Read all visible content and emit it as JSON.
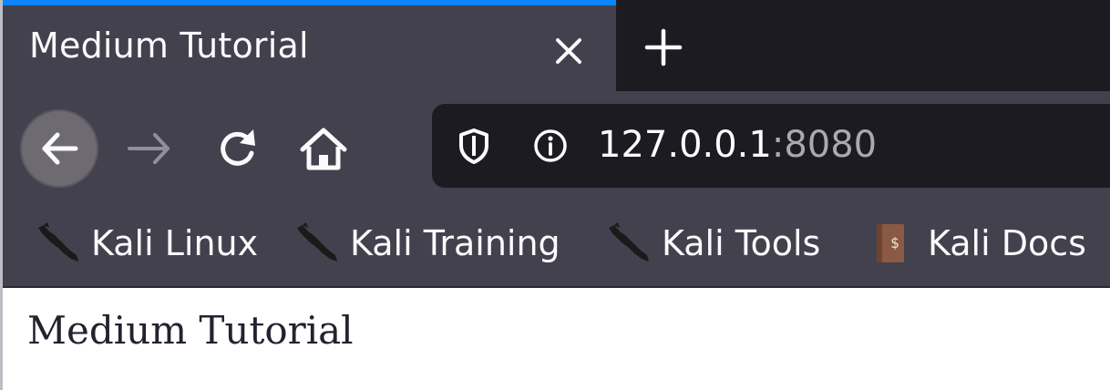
{
  "tab": {
    "title": "Medium Tutorial",
    "close_icon": "close-icon",
    "new_tab_icon": "plus-icon"
  },
  "nav": {
    "back_icon": "back-arrow-icon",
    "forward_icon": "forward-arrow-icon",
    "reload_icon": "reload-icon",
    "home_icon": "home-icon"
  },
  "urlbar": {
    "host": "127.0.0.1",
    "port": ":8080",
    "tracking_icon": "shield-icon",
    "info_icon": "info-icon"
  },
  "bookmarks": [
    {
      "label": "Kali Linux",
      "icon": "kali-dragon-icon"
    },
    {
      "label": "Kali Training",
      "icon": "kali-dragon-icon"
    },
    {
      "label": "Kali Tools",
      "icon": "kali-dragon-icon"
    },
    {
      "label": "Kali Docs",
      "icon": "docs-book-icon"
    }
  ],
  "page": {
    "heading": "Medium Tutorial"
  },
  "colors": {
    "accent": "#0a84ff",
    "toolbar": "#42414d",
    "tabstrip": "#1c1b22",
    "urlbar": "#1c1b22",
    "text": "#fbfbfe",
    "port_text": "#a9a9b3"
  }
}
